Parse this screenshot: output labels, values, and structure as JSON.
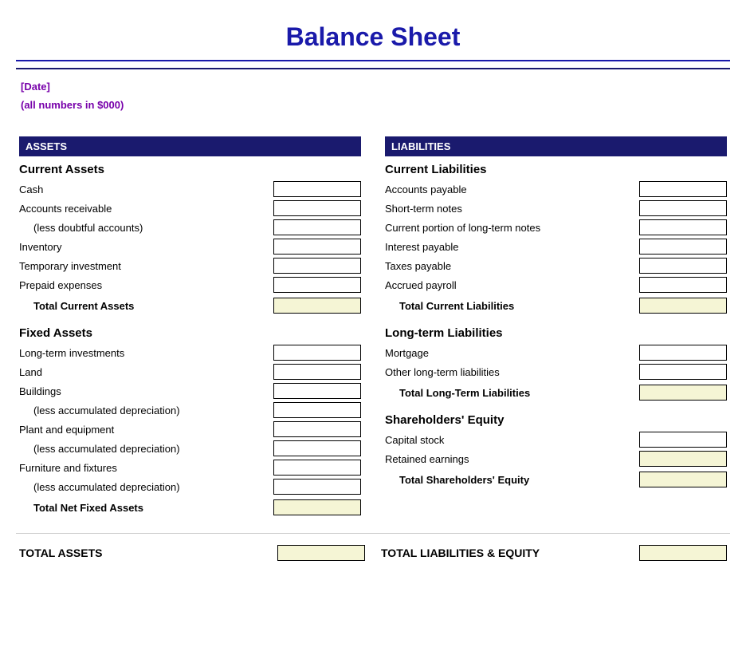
{
  "title": "Balance Sheet",
  "subtitle_date": "[Date]",
  "subtitle_numbers": "(all numbers in $000)",
  "left_section_header": "ASSETS",
  "right_section_header": "LIABILITIES",
  "current_assets": {
    "title": "Current Assets",
    "items": [
      {
        "label": "Cash",
        "indent": false
      },
      {
        "label": "Accounts receivable",
        "indent": false
      },
      {
        "label": "(less doubtful accounts)",
        "indent": true
      },
      {
        "label": "Inventory",
        "indent": false
      },
      {
        "label": "Temporary investment",
        "indent": false
      },
      {
        "label": "Prepaid expenses",
        "indent": false
      }
    ],
    "total_label": "Total Current Assets"
  },
  "fixed_assets": {
    "title": "Fixed Assets",
    "items": [
      {
        "label": "Long-term investments",
        "indent": false
      },
      {
        "label": "Land",
        "indent": false
      },
      {
        "label": "Buildings",
        "indent": false
      },
      {
        "label": "(less accumulated depreciation)",
        "indent": true
      },
      {
        "label": "Plant and equipment",
        "indent": false
      },
      {
        "label": "(less accumulated depreciation)",
        "indent": true
      },
      {
        "label": "Furniture and fixtures",
        "indent": false
      },
      {
        "label": "(less accumulated depreciation)",
        "indent": true
      }
    ],
    "total_label": "Total Net Fixed Assets"
  },
  "total_assets_label": "TOTAL ASSETS",
  "current_liabilities": {
    "title": "Current Liabilities",
    "items": [
      {
        "label": "Accounts payable",
        "indent": false
      },
      {
        "label": "Short-term notes",
        "indent": false
      },
      {
        "label": "Current portion of long-term notes",
        "indent": false
      },
      {
        "label": "Interest payable",
        "indent": false
      },
      {
        "label": "Taxes payable",
        "indent": false
      },
      {
        "label": "Accrued payroll",
        "indent": false
      }
    ],
    "total_label": "Total Current Liabilities"
  },
  "longterm_liabilities": {
    "title": "Long-term Liabilities",
    "items": [
      {
        "label": "Mortgage",
        "indent": false
      },
      {
        "label": "Other long-term liabilities",
        "indent": false
      }
    ],
    "total_label": "Total Long-Term Liabilities"
  },
  "shareholders_equity": {
    "title": "Shareholders' Equity",
    "items": [
      {
        "label": "Capital stock",
        "indent": false
      },
      {
        "label": "Retained earnings",
        "indent": false
      }
    ],
    "total_label": "Total Shareholders' Equity"
  },
  "total_liabilities_equity_label": "TOTAL LIABILITIES & EQUITY"
}
